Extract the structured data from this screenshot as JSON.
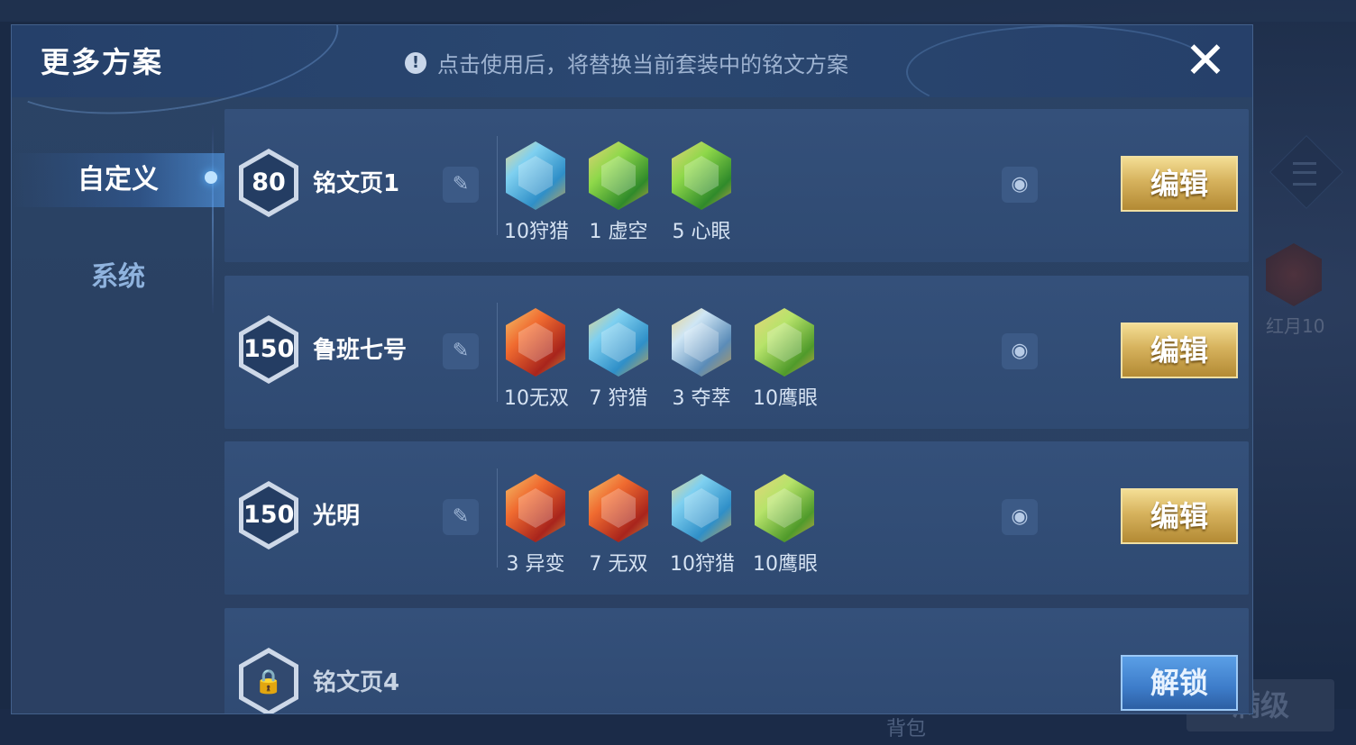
{
  "background": {
    "side_label": "红月10",
    "full_level_label": "满级",
    "bottom_tab_label": "背包"
  },
  "modal": {
    "title": "更多方案",
    "notice": "点击使用后，将替换当前套装中的铭文方案",
    "close_label": "✕"
  },
  "tabs": [
    {
      "label": "自定义",
      "active": true
    },
    {
      "label": "系统",
      "active": false
    }
  ],
  "pages": [
    {
      "level": "80",
      "name": "铭文页1",
      "runes": [
        {
          "label": "10狩猎",
          "color": "blue"
        },
        {
          "label": "1 虚空",
          "color": "green"
        },
        {
          "label": "5 心眼",
          "color": "green"
        }
      ],
      "action": "编辑"
    },
    {
      "level": "150",
      "name": "鲁班七号",
      "runes": [
        {
          "label": "10无双",
          "color": "red"
        },
        {
          "label": "7 狩猎",
          "color": "blue"
        },
        {
          "label": "3 夺萃",
          "color": "silver"
        },
        {
          "label": "10鹰眼",
          "color": "lime"
        }
      ],
      "action": "编辑"
    },
    {
      "level": "150",
      "name": "光明",
      "runes": [
        {
          "label": "3 异变",
          "color": "red"
        },
        {
          "label": "7 无双",
          "color": "red"
        },
        {
          "label": "10狩猎",
          "color": "blue"
        },
        {
          "label": "10鹰眼",
          "color": "lime"
        }
      ],
      "action": "编辑"
    },
    {
      "level": "",
      "name": "铭文页4",
      "locked": true,
      "action": "解锁"
    }
  ],
  "icons": {
    "rename": "pen-icon",
    "preview": "eye-icon",
    "info": "exclamation-icon",
    "lock": "lock-icon"
  }
}
